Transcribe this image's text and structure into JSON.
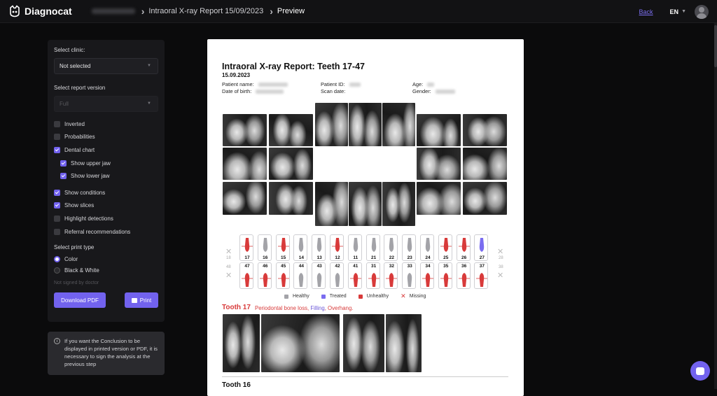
{
  "header": {
    "brand": "Diagnocat",
    "breadcrumbs": [
      "Intraoral X-ray Report 15/09/2023",
      "Preview"
    ],
    "back_label": "Back",
    "language": "EN"
  },
  "settings": {
    "clinic_label": "Select clinic:",
    "clinic_value": "Not selected",
    "version_label": "Select report version",
    "version_value": "Full",
    "options": [
      {
        "label": "Inverted",
        "checked": false,
        "indent": false
      },
      {
        "label": "Probabilities",
        "checked": false,
        "indent": false
      },
      {
        "label": "Dental chart",
        "checked": true,
        "indent": false
      },
      {
        "label": "Show upper jaw",
        "checked": true,
        "indent": true
      },
      {
        "label": "Show lower jaw",
        "checked": true,
        "indent": true
      },
      {
        "label": "Show conditions",
        "checked": true,
        "indent": false
      },
      {
        "label": "Show slices",
        "checked": true,
        "indent": false
      },
      {
        "label": "Highlight detections",
        "checked": false,
        "indent": false
      },
      {
        "label": "Referral recommendations",
        "checked": false,
        "indent": false
      }
    ],
    "print_type_label": "Select print type",
    "print_types": [
      {
        "label": "Color",
        "selected": true
      },
      {
        "label": "Black & White",
        "selected": false
      }
    ],
    "not_signed": "Not signed by doctor",
    "download_label": "Download PDF",
    "print_label": "Print",
    "info": "If you want the Conclusion to be displayed in printed version or PDF, it is necessary to sign the analysis at the previous step"
  },
  "report": {
    "title": "Intraoral X-ray Report: Teeth 17-47",
    "date": "15.09.2023",
    "patient_name_label": "Patient name:",
    "dob_label": "Date of birth:",
    "patient_id_label": "Patient ID:",
    "scan_date_label": "Scan date:",
    "age_label": "Age:",
    "gender_label": "Gender:",
    "upper_teeth": [
      {
        "num": "17",
        "status": "unhealthy"
      },
      {
        "num": "16",
        "status": "healthy"
      },
      {
        "num": "15",
        "status": "unhealthy"
      },
      {
        "num": "14",
        "status": "healthy"
      },
      {
        "num": "13",
        "status": "healthy"
      },
      {
        "num": "12",
        "status": "unhealthy"
      },
      {
        "num": "11",
        "status": "healthy"
      },
      {
        "num": "21",
        "status": "healthy"
      },
      {
        "num": "22",
        "status": "healthy"
      },
      {
        "num": "23",
        "status": "healthy"
      },
      {
        "num": "24",
        "status": "healthy"
      },
      {
        "num": "25",
        "status": "unhealthy"
      },
      {
        "num": "26",
        "status": "unhealthy"
      },
      {
        "num": "27",
        "status": "treated"
      }
    ],
    "lower_teeth": [
      {
        "num": "47",
        "status": "unhealthy"
      },
      {
        "num": "46",
        "status": "unhealthy"
      },
      {
        "num": "45",
        "status": "unhealthy"
      },
      {
        "num": "44",
        "status": "healthy"
      },
      {
        "num": "43",
        "status": "healthy"
      },
      {
        "num": "42",
        "status": "healthy"
      },
      {
        "num": "41",
        "status": "unhealthy"
      },
      {
        "num": "31",
        "status": "unhealthy"
      },
      {
        "num": "32",
        "status": "unhealthy"
      },
      {
        "num": "33",
        "status": "healthy"
      },
      {
        "num": "34",
        "status": "unhealthy"
      },
      {
        "num": "35",
        "status": "unhealthy"
      },
      {
        "num": "36",
        "status": "unhealthy"
      },
      {
        "num": "37",
        "status": "unhealthy"
      }
    ],
    "missing_left_upper": "18",
    "missing_left_lower": "48",
    "missing_right_upper": "28",
    "missing_right_lower": "38",
    "legend": {
      "healthy": "Healthy",
      "treated": "Treated",
      "unhealthy": "Unhealthy",
      "missing": "Missing"
    },
    "tooth17_title": "Tooth 17",
    "tooth17_cond1": "Periodontal bone loss, ",
    "tooth17_cond2": "Filling",
    "tooth17_cond3": ", Overhang.",
    "tooth16_title": "Tooth 16"
  },
  "colors": {
    "accent": "#7262ee",
    "healthy": "#a3a3a8",
    "unhealthy": "#d83a3a",
    "treated": "#7a6cf0"
  }
}
